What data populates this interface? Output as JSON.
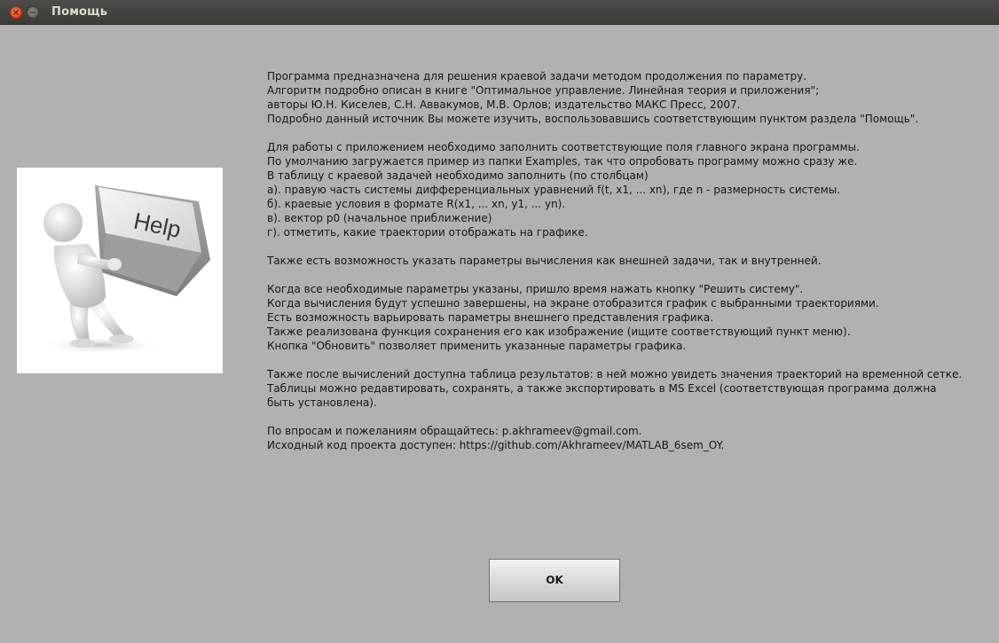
{
  "window": {
    "title": "Помощь",
    "close_glyph": "×",
    "minimize_glyph": "−"
  },
  "image": {
    "key_label": "Help",
    "icon": "help-key-figure"
  },
  "help_lines": [
    "Программа предназначена для решения краевой задачи методом продолжения по параметру.",
    "Алгоритм подробно описан в книге \"Оптимальное управление. Линейная теория и приложения\";",
    "авторы Ю.Н. Киселев, С.Н. Аввакумов, М.В. Орлов; издательство МАКС Пресс, 2007.",
    "Подробно данный источник Вы можете изучить, воспользовавшись соответствующим пунктом раздела \"Помощь\".",
    "",
    "Для работы с приложением необходимо заполнить соответствующие поля главного экрана программы.",
    "По умолчанию загружается пример из папки Examples, так что опробовать программу можно сразу же.",
    "В таблицу с краевой задачей необходимо заполнить (по столбцам)",
    "а). правую часть системы дифференциальных уравнений f(t, x1, ... xn), где n - размерность системы.",
    "б). краевые условия в формате R(x1, ... xn, y1, ... yn).",
    "в). вектор p0 (начальное приближение)",
    "г). отметить, какие траектории отображать на графике.",
    "",
    "Также есть возможность указать параметры вычисления как внешней задачи, так и внутренней.",
    "",
    "Когда все необходимые параметры указаны, пришло время нажать кнопку \"Решить систему\".",
    "Когда вычисления будут успешно завершены, на экране отобразится график с выбранными траекториями.",
    "Есть возможность варьировать параметры внешнего представления графика.",
    "Также реализована функция сохранения его как изображение (ищите соответствующий пункт меню).",
    "Кнопка \"Обновить\" позволяет применить указанные параметры графика.",
    "",
    "Также после вычислений доступна таблица результатов: в ней можно увидеть значения траекторий на временной сетке.",
    "Таблицы можно редавтировать, сохранять, а также экспортировать в MS Excel (соответствующая программа должна",
    "быть установлена).",
    "",
    "По впросам и пожеланиям обращайтесь: p.akhrameev@gmail.com.",
    "Исходный код проекта доступен: https://github.com/Akhrameev/MATLAB_6sem_OY."
  ],
  "ok_button": {
    "label": "OK"
  }
}
